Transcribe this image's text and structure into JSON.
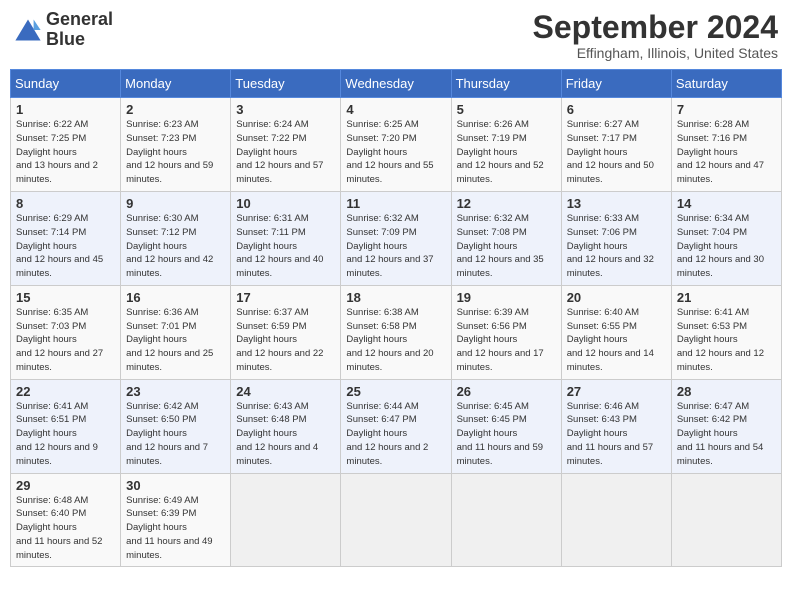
{
  "header": {
    "logo_line1": "General",
    "logo_line2": "Blue",
    "month": "September 2024",
    "location": "Effingham, Illinois, United States"
  },
  "days_of_week": [
    "Sunday",
    "Monday",
    "Tuesday",
    "Wednesday",
    "Thursday",
    "Friday",
    "Saturday"
  ],
  "weeks": [
    [
      {
        "day": "1",
        "sunrise": "6:22 AM",
        "sunset": "7:25 PM",
        "daylight": "13 hours and 2 minutes."
      },
      {
        "day": "2",
        "sunrise": "6:23 AM",
        "sunset": "7:23 PM",
        "daylight": "12 hours and 59 minutes."
      },
      {
        "day": "3",
        "sunrise": "6:24 AM",
        "sunset": "7:22 PM",
        "daylight": "12 hours and 57 minutes."
      },
      {
        "day": "4",
        "sunrise": "6:25 AM",
        "sunset": "7:20 PM",
        "daylight": "12 hours and 55 minutes."
      },
      {
        "day": "5",
        "sunrise": "6:26 AM",
        "sunset": "7:19 PM",
        "daylight": "12 hours and 52 minutes."
      },
      {
        "day": "6",
        "sunrise": "6:27 AM",
        "sunset": "7:17 PM",
        "daylight": "12 hours and 50 minutes."
      },
      {
        "day": "7",
        "sunrise": "6:28 AM",
        "sunset": "7:16 PM",
        "daylight": "12 hours and 47 minutes."
      }
    ],
    [
      {
        "day": "8",
        "sunrise": "6:29 AM",
        "sunset": "7:14 PM",
        "daylight": "12 hours and 45 minutes."
      },
      {
        "day": "9",
        "sunrise": "6:30 AM",
        "sunset": "7:12 PM",
        "daylight": "12 hours and 42 minutes."
      },
      {
        "day": "10",
        "sunrise": "6:31 AM",
        "sunset": "7:11 PM",
        "daylight": "12 hours and 40 minutes."
      },
      {
        "day": "11",
        "sunrise": "6:32 AM",
        "sunset": "7:09 PM",
        "daylight": "12 hours and 37 minutes."
      },
      {
        "day": "12",
        "sunrise": "6:32 AM",
        "sunset": "7:08 PM",
        "daylight": "12 hours and 35 minutes."
      },
      {
        "day": "13",
        "sunrise": "6:33 AM",
        "sunset": "7:06 PM",
        "daylight": "12 hours and 32 minutes."
      },
      {
        "day": "14",
        "sunrise": "6:34 AM",
        "sunset": "7:04 PM",
        "daylight": "12 hours and 30 minutes."
      }
    ],
    [
      {
        "day": "15",
        "sunrise": "6:35 AM",
        "sunset": "7:03 PM",
        "daylight": "12 hours and 27 minutes."
      },
      {
        "day": "16",
        "sunrise": "6:36 AM",
        "sunset": "7:01 PM",
        "daylight": "12 hours and 25 minutes."
      },
      {
        "day": "17",
        "sunrise": "6:37 AM",
        "sunset": "6:59 PM",
        "daylight": "12 hours and 22 minutes."
      },
      {
        "day": "18",
        "sunrise": "6:38 AM",
        "sunset": "6:58 PM",
        "daylight": "12 hours and 20 minutes."
      },
      {
        "day": "19",
        "sunrise": "6:39 AM",
        "sunset": "6:56 PM",
        "daylight": "12 hours and 17 minutes."
      },
      {
        "day": "20",
        "sunrise": "6:40 AM",
        "sunset": "6:55 PM",
        "daylight": "12 hours and 14 minutes."
      },
      {
        "day": "21",
        "sunrise": "6:41 AM",
        "sunset": "6:53 PM",
        "daylight": "12 hours and 12 minutes."
      }
    ],
    [
      {
        "day": "22",
        "sunrise": "6:41 AM",
        "sunset": "6:51 PM",
        "daylight": "12 hours and 9 minutes."
      },
      {
        "day": "23",
        "sunrise": "6:42 AM",
        "sunset": "6:50 PM",
        "daylight": "12 hours and 7 minutes."
      },
      {
        "day": "24",
        "sunrise": "6:43 AM",
        "sunset": "6:48 PM",
        "daylight": "12 hours and 4 minutes."
      },
      {
        "day": "25",
        "sunrise": "6:44 AM",
        "sunset": "6:47 PM",
        "daylight": "12 hours and 2 minutes."
      },
      {
        "day": "26",
        "sunrise": "6:45 AM",
        "sunset": "6:45 PM",
        "daylight": "11 hours and 59 minutes."
      },
      {
        "day": "27",
        "sunrise": "6:46 AM",
        "sunset": "6:43 PM",
        "daylight": "11 hours and 57 minutes."
      },
      {
        "day": "28",
        "sunrise": "6:47 AM",
        "sunset": "6:42 PM",
        "daylight": "11 hours and 54 minutes."
      }
    ],
    [
      {
        "day": "29",
        "sunrise": "6:48 AM",
        "sunset": "6:40 PM",
        "daylight": "11 hours and 52 minutes."
      },
      {
        "day": "30",
        "sunrise": "6:49 AM",
        "sunset": "6:39 PM",
        "daylight": "11 hours and 49 minutes."
      },
      null,
      null,
      null,
      null,
      null
    ]
  ]
}
